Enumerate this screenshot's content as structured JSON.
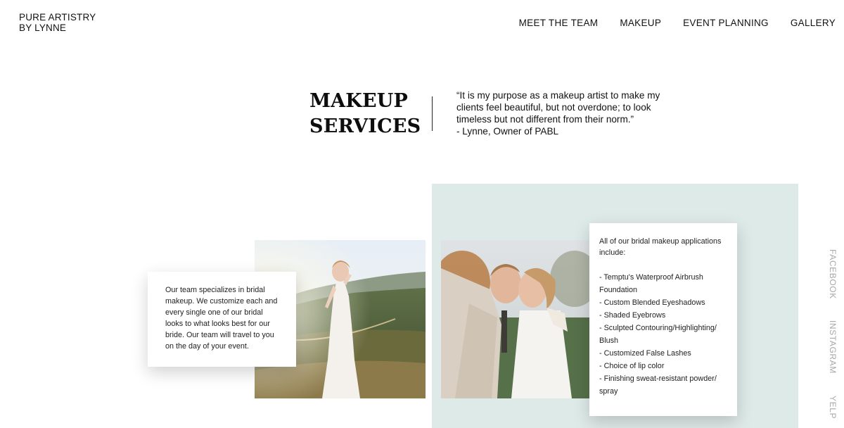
{
  "brand": {
    "line1": "PURE ARTISTRY",
    "line2": "BY LYNNE"
  },
  "nav": {
    "items": [
      {
        "label": "MEET THE TEAM"
      },
      {
        "label": "MAKEUP"
      },
      {
        "label": "EVENT PLANNING"
      },
      {
        "label": "GALLERY"
      }
    ]
  },
  "hero": {
    "title_line1": "MAKEUP",
    "title_line2": "SERVICES",
    "quote_lines": [
      "“It is my purpose as a makeup artist to make my",
      "clients feel beautiful, but not overdone; to look",
      "timeless but not different from their norm.”",
      "- Lynne, Owner of PABL"
    ]
  },
  "intro_card": {
    "text": "Our team specializes in bridal makeup. We customize each and every single one of our bridal looks to what looks best for our bride.  Our team will travel to you on the day of your event."
  },
  "services_card": {
    "intro": "All of our bridal makeup applications include:",
    "items": [
      "- Temptu's Waterproof Airbrush Foundation",
      "- Custom Blended Eyeshadows",
      "- Shaded Eyebrows",
      "- Sculpted Contouring/Highlighting/ Blush",
      "- Customized False Lashes",
      "- Choice of lip color",
      "- Finishing sweat-resistant powder/ spray"
    ]
  },
  "social": {
    "facebook": "FACEBOOK",
    "instagram": "INSTAGRAM",
    "yelp": "YELP"
  },
  "colors": {
    "panel": "#deeae8",
    "text": "#111111",
    "social_text": "#a8a8a8"
  }
}
